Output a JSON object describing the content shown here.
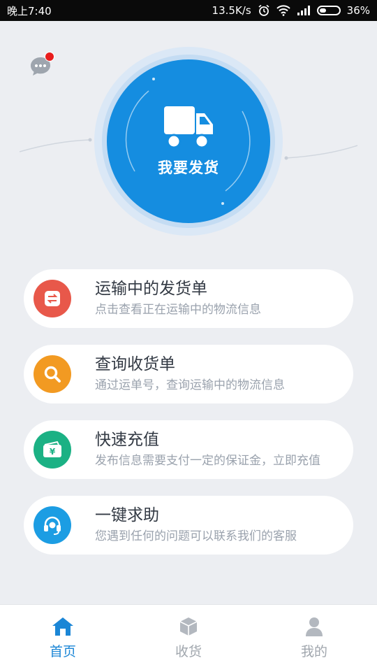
{
  "status_bar": {
    "time": "晚上7:40",
    "network_speed": "13.5K/s",
    "battery": "36%",
    "icons": [
      "alarm-icon",
      "wifi-icon",
      "signal-icon",
      "battery-icon"
    ]
  },
  "header": {
    "message_icon": "chat-bubble-icon",
    "has_unread": true
  },
  "hero": {
    "label": "我要发货",
    "icon": "truck-icon"
  },
  "menu": [
    {
      "title": "运输中的发货单",
      "subtitle": "点击查看正在运输中的物流信息",
      "icon": "exchange-icon",
      "color": "#e8584a"
    },
    {
      "title": "查询收货单",
      "subtitle": "通过运单号，查询运输中的物流信息",
      "icon": "search-icon",
      "color": "#f29a22"
    },
    {
      "title": "快速充值",
      "subtitle": "发布信息需要支付一定的保证金，立即充值",
      "icon": "wallet-icon",
      "color": "#1bb184"
    },
    {
      "title": "一键求助",
      "subtitle": "您遇到任何的问题可以联系我们的客服",
      "icon": "headset-icon",
      "color": "#1c9de3"
    }
  ],
  "tabs": [
    {
      "label": "首页",
      "icon": "home-icon",
      "active": true
    },
    {
      "label": "收货",
      "icon": "box-icon",
      "active": false
    },
    {
      "label": "我的",
      "icon": "user-icon",
      "active": false
    }
  ],
  "colors": {
    "primary": "#158de0",
    "background": "#eceef2",
    "tab_active": "#1b86d6",
    "tab_inactive": "#a0a6ad"
  }
}
